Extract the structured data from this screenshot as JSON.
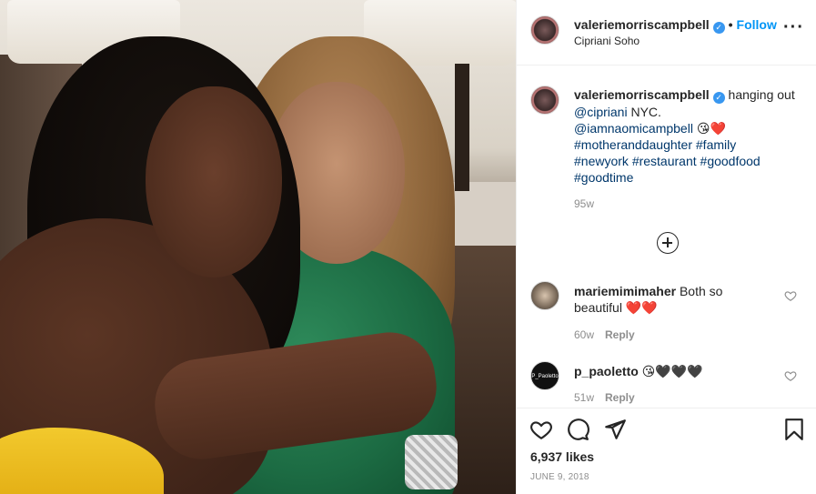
{
  "post": {
    "username": "valeriemorriscampbell",
    "verified_icon": "verified-badge-icon",
    "follow_label": "Follow",
    "location": "Cipriani Soho",
    "more_icon": "more-options-icon"
  },
  "caption": {
    "username": "valeriemorriscampbell",
    "text_start": "hanging out ",
    "mention1": "@cipriani",
    "text_mid": " NYC.",
    "mention2": "@iamnaomicampbell",
    "emoji": "😘",
    "heart": "❤️",
    "hashtags": [
      "#motheranddaughter",
      "#family",
      "#newyork",
      "#restaurant",
      "#goodfood",
      "#goodtime"
    ],
    "time": "95w"
  },
  "comments": [
    {
      "username": "mariemimimaher",
      "text": "Both so beautiful",
      "emoji": "❤️❤️",
      "time": "60w",
      "reply_label": "Reply"
    },
    {
      "username": "p_paoletto",
      "text": "",
      "emoji": "😘🖤🖤🖤",
      "time": "51w",
      "reply_label": "Reply",
      "avatar_text": "P_Paoletto Images Presentation"
    }
  ],
  "actions": {
    "likes": "6,937 likes",
    "date": "JUNE 9, 2018"
  },
  "colors": {
    "accent": "#0095f6",
    "hashtag": "#00376b",
    "muted": "#8e8e8e"
  }
}
